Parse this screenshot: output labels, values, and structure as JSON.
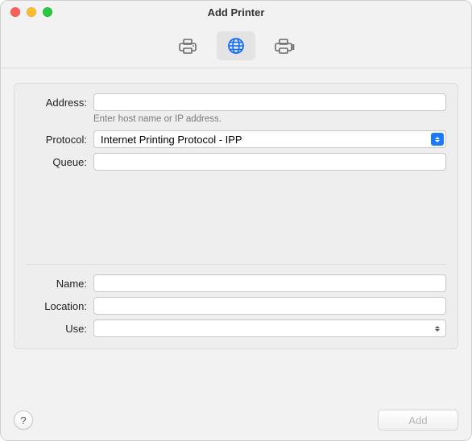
{
  "window": {
    "title": "Add Printer"
  },
  "tabs": {
    "default_label": "Default",
    "ip_label": "IP",
    "windows_label": "Windows",
    "selected": "ip"
  },
  "form": {
    "address_label": "Address:",
    "address_value": "",
    "address_hint": "Enter host name or IP address.",
    "protocol_label": "Protocol:",
    "protocol_value": "Internet Printing Protocol - IPP",
    "queue_label": "Queue:",
    "queue_value": ""
  },
  "meta": {
    "name_label": "Name:",
    "name_value": "",
    "location_label": "Location:",
    "location_value": "",
    "use_label": "Use:",
    "use_value": ""
  },
  "footer": {
    "help_label": "?",
    "add_label": "Add"
  }
}
